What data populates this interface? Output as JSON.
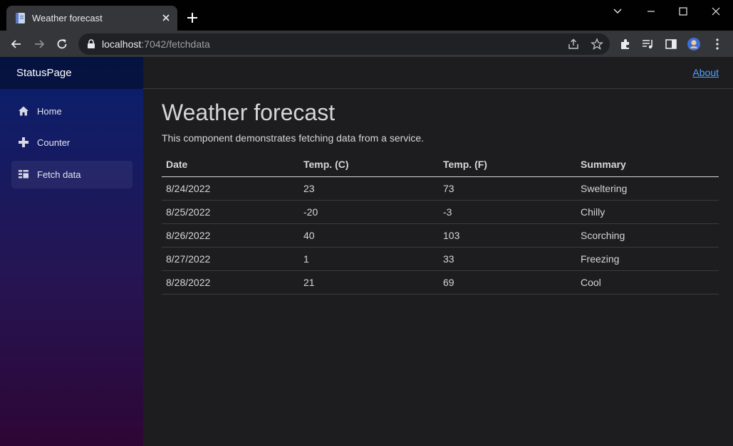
{
  "browser": {
    "tab_title": "Weather forecast",
    "url_host": "localhost",
    "url_path": ":7042/fetchdata"
  },
  "app": {
    "brand": "StatusPage",
    "nav": [
      {
        "label": "Home",
        "icon": "home-icon"
      },
      {
        "label": "Counter",
        "icon": "plus-icon"
      },
      {
        "label": "Fetch data",
        "icon": "list-icon"
      }
    ],
    "about_label": "About"
  },
  "page": {
    "title": "Weather forecast",
    "intro": "This component demonstrates fetching data from a service."
  },
  "table": {
    "headers": [
      "Date",
      "Temp. (C)",
      "Temp. (F)",
      "Summary"
    ],
    "rows": [
      [
        "8/24/2022",
        "23",
        "73",
        "Sweltering"
      ],
      [
        "8/25/2022",
        "-20",
        "-3",
        "Chilly"
      ],
      [
        "8/26/2022",
        "40",
        "103",
        "Scorching"
      ],
      [
        "8/27/2022",
        "1",
        "33",
        "Freezing"
      ],
      [
        "8/28/2022",
        "21",
        "69",
        "Cool"
      ]
    ]
  },
  "colors": {
    "link": "#4fa3ff",
    "sidebar_top": "#08206d",
    "sidebar_bottom": "#2e0635",
    "background": "#1d1d1f"
  }
}
